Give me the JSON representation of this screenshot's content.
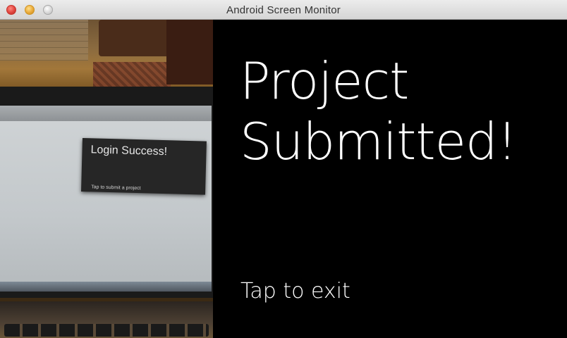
{
  "window": {
    "title": "Android Screen Monitor",
    "controls": {
      "close": "close-window",
      "minimize": "minimize-window",
      "maximize": "maximize-window"
    }
  },
  "photo": {
    "card_title": "Login Success!",
    "card_subtitle": "Tap to submit a project"
  },
  "glass_screen": {
    "heading_line1": "Project",
    "heading_line2": "Submitted!",
    "action_text": "Tap to exit"
  },
  "colors": {
    "screen_background": "#000000",
    "screen_text": "#ffffff",
    "titlebar": "#e2e2e2"
  }
}
